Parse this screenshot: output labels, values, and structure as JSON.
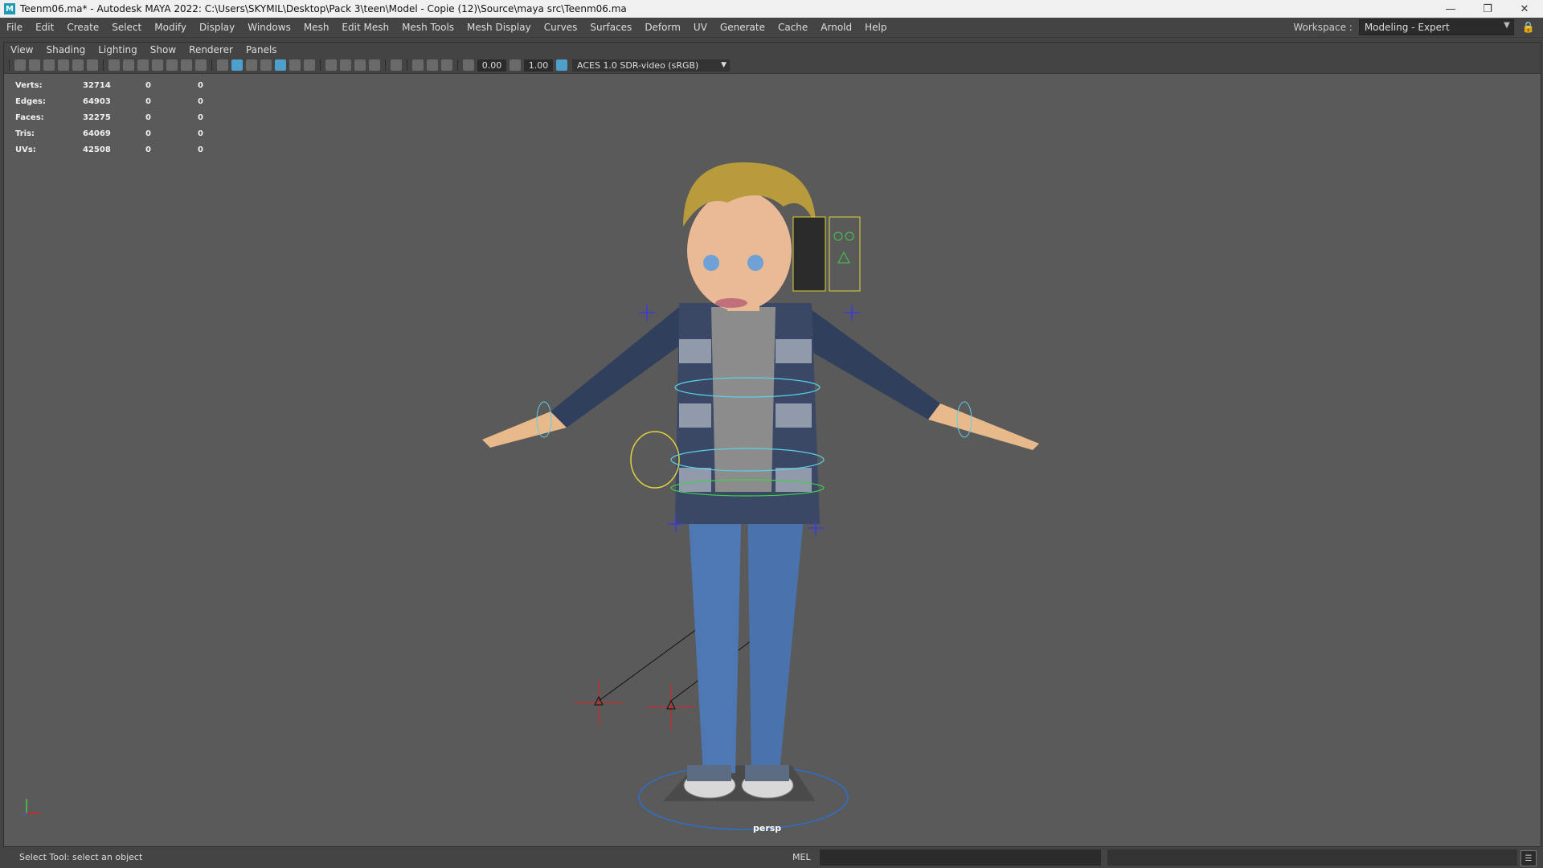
{
  "window": {
    "title": "Teenm06.ma* - Autodesk MAYA 2022: C:\\Users\\SKYMIL\\Desktop\\Pack 3\\teen\\Model - Copie (12)\\Source\\maya src\\Teenm06.ma",
    "logo": "M"
  },
  "menubar": [
    "File",
    "Edit",
    "Create",
    "Select",
    "Modify",
    "Display",
    "Windows",
    "Mesh",
    "Edit Mesh",
    "Mesh Tools",
    "Mesh Display",
    "Curves",
    "Surfaces",
    "Deform",
    "UV",
    "Generate",
    "Cache",
    "Arnold",
    "Help"
  ],
  "workspace": {
    "label": "Workspace :",
    "value": "Modeling - Expert"
  },
  "panel_menu": [
    "View",
    "Shading",
    "Lighting",
    "Show",
    "Renderer",
    "Panels"
  ],
  "panel_toolbar": {
    "exposure": "0.00",
    "gamma": "1.00",
    "color_space": "ACES 1.0 SDR-video (sRGB)"
  },
  "hud": {
    "rows": [
      {
        "label": "Verts:",
        "value": "32714",
        "sel": "0",
        "comp": "0"
      },
      {
        "label": "Edges:",
        "value": "64903",
        "sel": "0",
        "comp": "0"
      },
      {
        "label": "Faces:",
        "value": "32275",
        "sel": "0",
        "comp": "0"
      },
      {
        "label": "Tris:",
        "value": "64069",
        "sel": "0",
        "comp": "0"
      },
      {
        "label": "UVs:",
        "value": "42508",
        "sel": "0",
        "comp": "0"
      }
    ]
  },
  "camera": "persp",
  "status": {
    "message": "Select Tool: select an object",
    "mel_label": "MEL"
  },
  "colors": {
    "viewport_bg": "#5a5a5a",
    "ui_bg": "#444444",
    "accent": "#4e9fc9"
  }
}
